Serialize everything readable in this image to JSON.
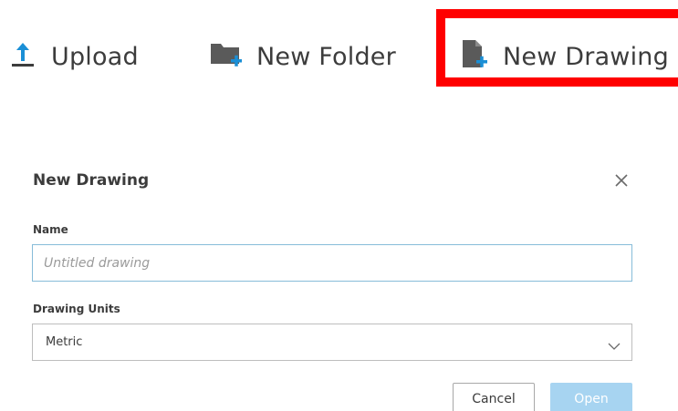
{
  "toolbar": {
    "upload_label": "Upload",
    "new_folder_label": "New Folder",
    "new_drawing_label": "New Drawing",
    "icons": {
      "upload": "upload-arrow-icon",
      "new_folder": "folder-plus-icon",
      "new_drawing": "file-plus-icon"
    },
    "highlight_color": "#ff0000"
  },
  "dialog": {
    "title": "New Drawing",
    "close_icon": "close-icon",
    "name_field": {
      "label": "Name",
      "value": "",
      "placeholder": "Untitled drawing"
    },
    "units_field": {
      "label": "Drawing Units",
      "selected": "Metric"
    },
    "buttons": {
      "cancel": "Cancel",
      "open": "Open"
    },
    "colors": {
      "accent": "#0696d7",
      "open_disabled": "#a7d4f1",
      "input_border_focus": "#87bcd9"
    }
  }
}
